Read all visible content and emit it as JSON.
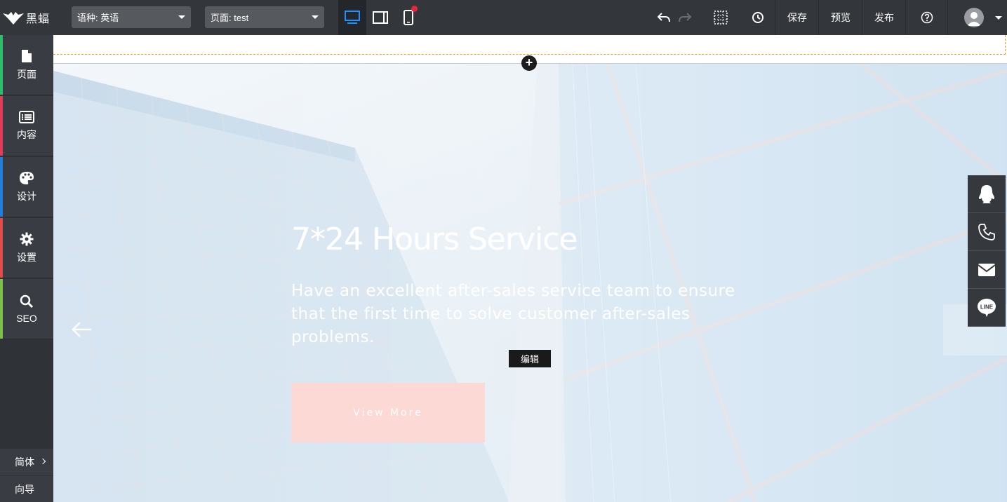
{
  "app": {
    "logo_text": "黑蝠"
  },
  "toolbar": {
    "language_select": "语种: 英语",
    "page_select": "页面: test",
    "save_label": "保存",
    "preview_label": "预览",
    "publish_label": "发布"
  },
  "sidebar": {
    "items": [
      {
        "label": "页面",
        "color": "#2ebd6b"
      },
      {
        "label": "内容",
        "color": "#e23c5a"
      },
      {
        "label": "设计",
        "color": "#1f7fe0"
      },
      {
        "label": "设置",
        "color": "#e34b4b"
      },
      {
        "label": "SEO",
        "color": "#7cc04a"
      }
    ],
    "language_label": "简体",
    "guide_label": "向导"
  },
  "banner": {
    "title": "7*24 Hours Service",
    "description": "Have an excellent after-sales service team to ensure that the first time to solve customer after-sales problems.",
    "button_label": "View More",
    "edit_label": "编辑"
  },
  "contact": {
    "items": [
      "qq-icon",
      "phone-icon",
      "mail-icon",
      "line-icon"
    ],
    "line_text": "LINE"
  },
  "colors": {
    "toolbar_bg": "#33363b",
    "active_device": "#1e90ff",
    "button_pink": "#fcd9d4"
  }
}
